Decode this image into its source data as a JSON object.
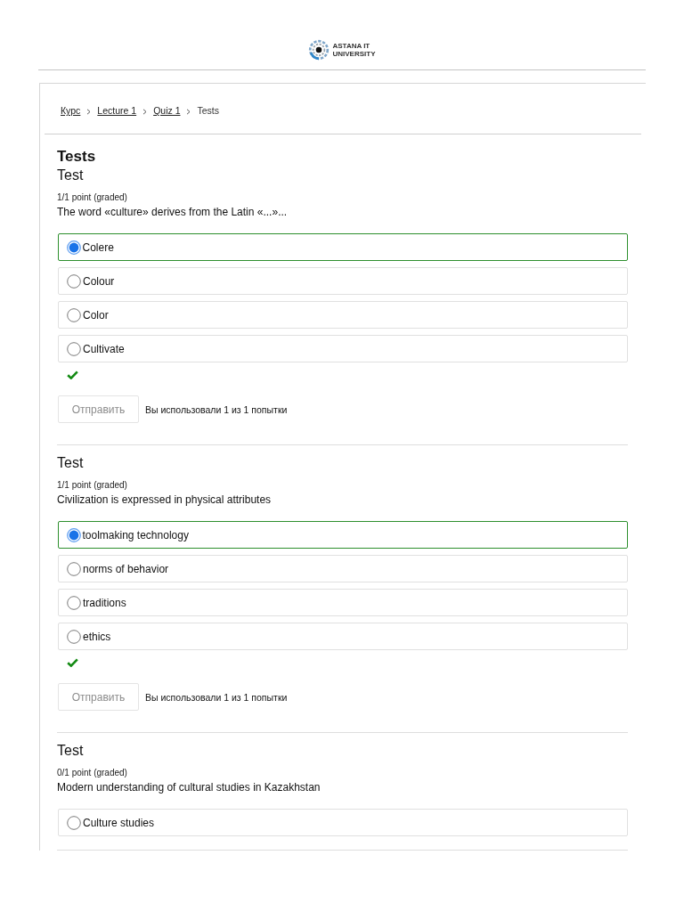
{
  "header": {
    "logo_text": [
      "ASTANA IT",
      "UNIVERSITY"
    ]
  },
  "breadcrumbs": [
    {
      "label": "Курс",
      "kind": "link"
    },
    {
      "label": "Lecture 1",
      "kind": "link"
    },
    {
      "label": "Quiz 1",
      "kind": "link"
    },
    {
      "label": "Tests",
      "kind": "current"
    }
  ],
  "page_title": "Tests",
  "problems": [
    {
      "title": "Test",
      "points": "1/1 point (graded)",
      "question": "The word «culture» derives from the Latin «...»...",
      "options": [
        {
          "label": "Colere",
          "selected": true
        },
        {
          "label": "Colour",
          "selected": false
        },
        {
          "label": "Color",
          "selected": false
        },
        {
          "label": "Cultivate",
          "selected": false
        }
      ],
      "correct": true,
      "submit": {
        "label": "Отправить",
        "disabled": true
      },
      "attempts": "Вы использовали 1 из 1 попытки"
    },
    {
      "title": "Test",
      "points": "1/1 point (graded)",
      "question": "Civilization is expressed in physical attributes",
      "options": [
        {
          "label": "toolmaking technology",
          "selected": true
        },
        {
          "label": "norms of behavior",
          "selected": false
        },
        {
          "label": "traditions",
          "selected": false
        },
        {
          "label": "ethics",
          "selected": false
        }
      ],
      "correct": true,
      "submit": {
        "label": "Отправить",
        "disabled": true
      },
      "attempts": "Вы использовали 1 из 1 попытки"
    },
    {
      "title": "Test",
      "points": "0/1 point (graded)",
      "question": "Modern understanding of cultural studies in Kazakhstan",
      "options": [
        {
          "label": "Culture studies",
          "selected": false
        }
      ]
    }
  ]
}
